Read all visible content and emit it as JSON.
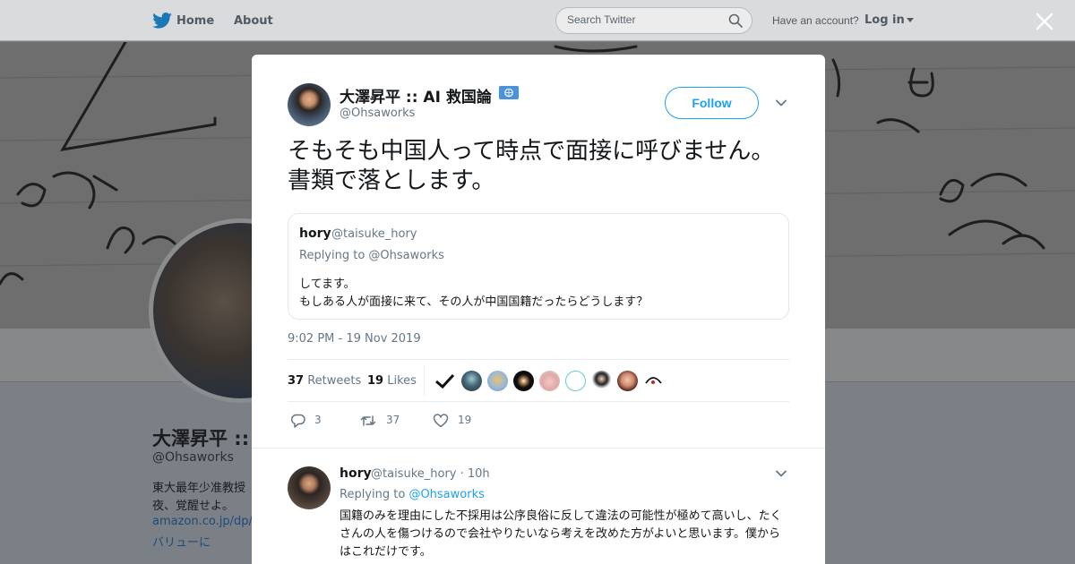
{
  "topbar": {
    "home_label": "Home",
    "about_label": "About",
    "search_placeholder": "Search Twitter",
    "have_account": "Have an account?",
    "login_label": "Log in"
  },
  "background_profile": {
    "name": "大澤昇平 ::",
    "handle": "@Ohsaworks",
    "bio_line1": "東大最年少准教授",
    "bio_line2": "夜、覚醒せよ。",
    "link_line1": "amazon.co.jp/dp/",
    "link_line2": "バリューに"
  },
  "tweet": {
    "author_name": "大澤昇平 :: AI 救国論",
    "author_handle": "@Ohsaworks",
    "follow_label": "Follow",
    "text": "そもそも中国人って時点で面接に呼びません。書類で落とします。",
    "timestamp": "9:02 PM - 19 Nov 2019",
    "retweets_count": "37",
    "retweets_label": "Retweets",
    "likes_count": "19",
    "likes_label": "Likes"
  },
  "quoted_tweet": {
    "name": "hory",
    "handle": "@taisuke_hory",
    "replying_to": "Replying to @Ohsaworks",
    "line1": "してます。",
    "line2": "もしある人が面接に来て、その人が中国国籍だったらどうします？"
  },
  "actions": {
    "replies": "3",
    "retweets": "37",
    "likes": "19"
  },
  "reply": {
    "name": "hory",
    "handle_time": "@taisuke_hory · 10h",
    "replying_prefix": "Replying to",
    "replying_handle": "@Ohsaworks",
    "text": "国籍のみを理由にした不採用は公序良俗に反して違法の可能性が極めて高いし、たくさんの人を傷つけるので会社やりたいなら考えを改めた方がよいと思います。僕からはこれだけです。"
  },
  "colors": {
    "accent": "#1da1f2",
    "secondary_text": "#657786",
    "primary_text": "#14171a",
    "verified_badge": "#4b92db"
  },
  "icons": {
    "logo": "twitter-bird-icon",
    "search": "search-icon",
    "close": "close-icon",
    "more": "chevron-down-icon",
    "reply": "reply-icon",
    "retweet": "retweet-icon",
    "like": "heart-icon",
    "badge": "un-flag-icon"
  }
}
